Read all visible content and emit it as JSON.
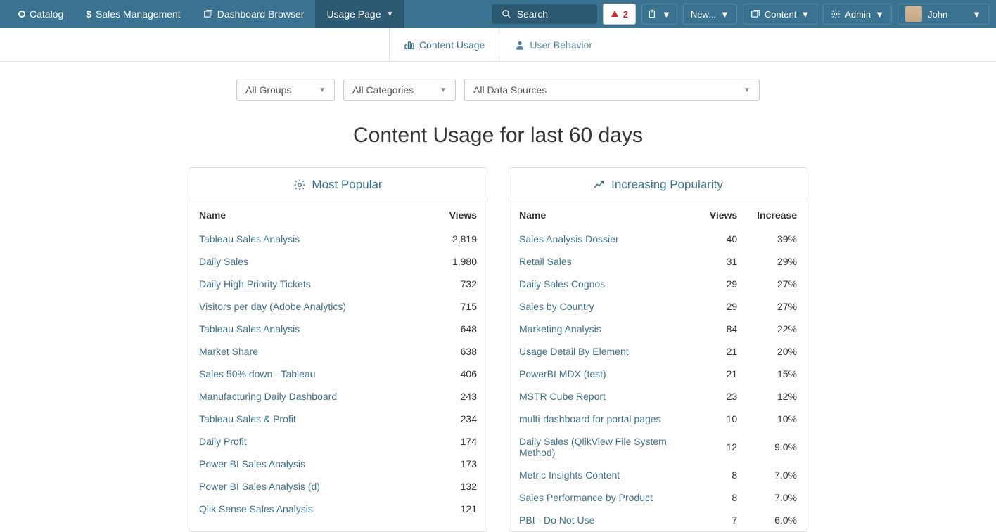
{
  "nav": {
    "catalog": "Catalog",
    "sales": "Sales Management",
    "dashboard": "Dashboard Browser",
    "usage": "Usage Page"
  },
  "topright": {
    "search": "Search",
    "alert_count": "2",
    "new": "New...",
    "content": "Content",
    "admin": "Admin",
    "user": "John"
  },
  "subtabs": {
    "content_usage": "Content Usage",
    "user_behavior": "User Behavior"
  },
  "filters": {
    "groups": "All Groups",
    "categories": "All Categories",
    "sources": "All Data Sources"
  },
  "title": "Content Usage for last 60 days",
  "popular": {
    "head": "Most Popular",
    "cols": {
      "name": "Name",
      "views": "Views"
    },
    "rows": [
      {
        "name": "Tableau Sales Analysis",
        "views": "2,819"
      },
      {
        "name": "Daily Sales",
        "views": "1,980"
      },
      {
        "name": "Daily High Priority Tickets",
        "views": "732"
      },
      {
        "name": "Visitors per day (Adobe Analytics)",
        "views": "715"
      },
      {
        "name": "Tableau Sales Analysis",
        "views": "648"
      },
      {
        "name": "Market Share",
        "views": "638"
      },
      {
        "name": "Sales 50% down - Tableau",
        "views": "406"
      },
      {
        "name": "Manufacturing Daily Dashboard",
        "views": "243"
      },
      {
        "name": "Tableau Sales & Profit",
        "views": "234"
      },
      {
        "name": "Daily Profit",
        "views": "174"
      },
      {
        "name": "Power BI Sales Analysis",
        "views": "173"
      },
      {
        "name": "Power BI Sales Analysis (d)",
        "views": "132"
      },
      {
        "name": "Qlik Sense Sales Analysis",
        "views": "121"
      }
    ]
  },
  "increasing": {
    "head": "Increasing Popularity",
    "cols": {
      "name": "Name",
      "views": "Views",
      "increase": "Increase"
    },
    "rows": [
      {
        "name": "Sales Analysis Dossier",
        "views": "40",
        "increase": "39%"
      },
      {
        "name": "Retail Sales",
        "views": "31",
        "increase": "29%"
      },
      {
        "name": "Daily Sales Cognos",
        "views": "29",
        "increase": "27%"
      },
      {
        "name": "Sales by Country",
        "views": "29",
        "increase": "27%"
      },
      {
        "name": "Marketing Analysis",
        "views": "84",
        "increase": "22%"
      },
      {
        "name": "Usage Detail By Element",
        "views": "21",
        "increase": "20%"
      },
      {
        "name": "PowerBI MDX (test)",
        "views": "21",
        "increase": "15%"
      },
      {
        "name": "MSTR Cube Report",
        "views": "23",
        "increase": "12%"
      },
      {
        "name": "multi-dashboard for portal pages",
        "views": "10",
        "increase": "10%"
      },
      {
        "name": "Daily Sales (QlikView File System Method)",
        "views": "12",
        "increase": "9.0%"
      },
      {
        "name": "Metric Insights Content",
        "views": "8",
        "increase": "7.0%"
      },
      {
        "name": "Sales Performance by Product",
        "views": "8",
        "increase": "7.0%"
      },
      {
        "name": "PBI - Do Not Use",
        "views": "7",
        "increase": "6.0%"
      }
    ]
  }
}
